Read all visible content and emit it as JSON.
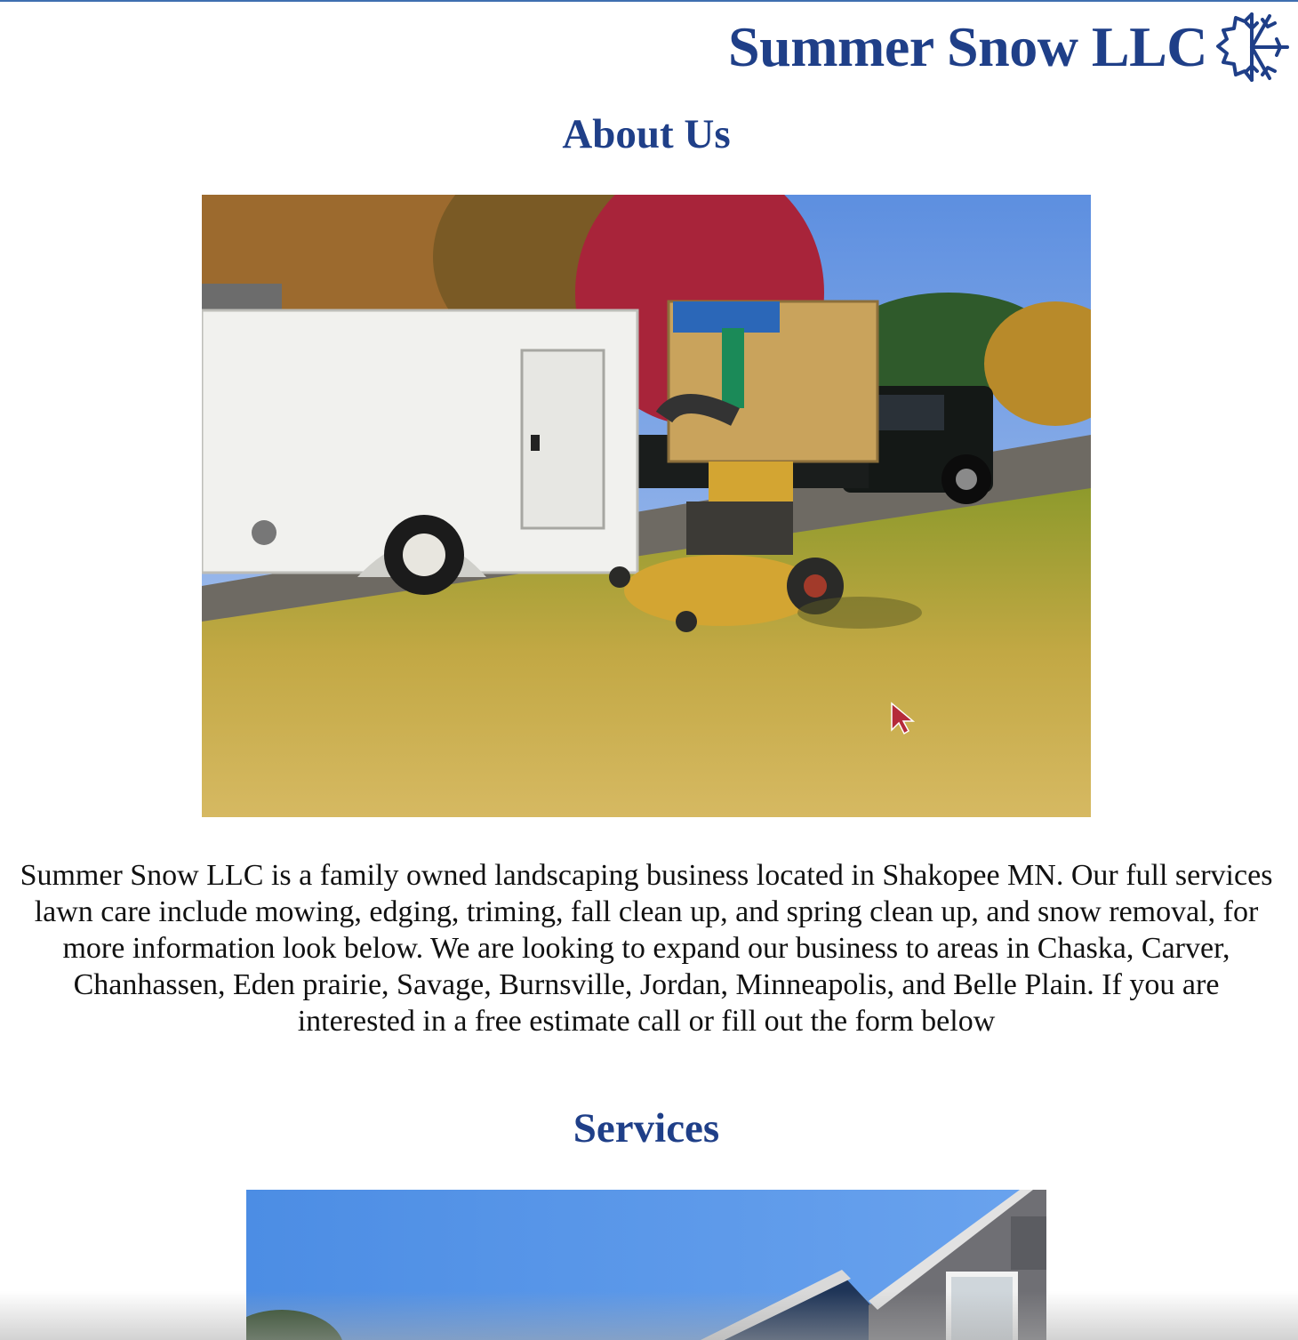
{
  "header": {
    "brand_title": "Summer Snow LLC",
    "logo_icon": "snowflake-sun-icon",
    "brand_color": "#1f3f88"
  },
  "about": {
    "heading": "About Us",
    "photo_alt": "White cargo trailer, yellow stand-on mower and pickup truck on lawn",
    "paragraph": "Summer Snow LLC is a family owned landscaping business located in Shakopee MN. Our full services lawn care include mowing, edging, triming, fall clean up, and spring clean up, and snow removal, for more information look below. We are looking to expand our business to areas in Chaska, Carver, Chanhassen, Eden prairie, Savage, Burnsville, Jordan, Minneapolis, and Belle Plain. If you are interested in a free estimate call or fill out the form below"
  },
  "services": {
    "heading": "Services",
    "photo_alt": "House with blue sky"
  }
}
